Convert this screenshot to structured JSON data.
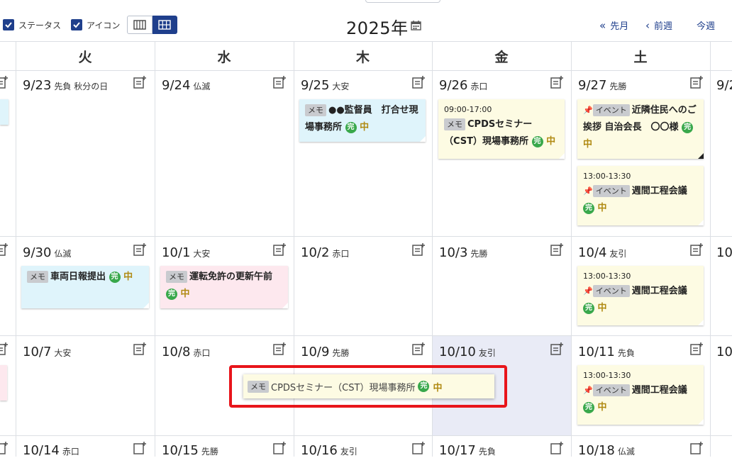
{
  "toolbar": {
    "status_label": "ステータス",
    "icon_label": "アイコン",
    "year": "2025年",
    "nav_prev_month": "先月",
    "nav_prev_week": "前週",
    "nav_this_week": "今週"
  },
  "weekdays": [
    "火",
    "水",
    "木",
    "金",
    "土"
  ],
  "cells": {
    "c_0923": {
      "date": "9/23",
      "rokuyo": "先負 秋分の日"
    },
    "c_0924": {
      "date": "9/24",
      "rokuyo": "仏滅"
    },
    "c_0925": {
      "date": "9/25",
      "rokuyo": "大安"
    },
    "c_0926": {
      "date": "9/26",
      "rokuyo": "赤口"
    },
    "c_0927": {
      "date": "9/27",
      "rokuyo": "先勝"
    },
    "c_0928": {
      "date": "9/2"
    },
    "c_0930": {
      "date": "9/30",
      "rokuyo": "仏滅"
    },
    "c_1001": {
      "date": "10/1",
      "rokuyo": "大安"
    },
    "c_1002": {
      "date": "10/2",
      "rokuyo": "赤口"
    },
    "c_1003": {
      "date": "10/3",
      "rokuyo": "先勝"
    },
    "c_1004": {
      "date": "10/4",
      "rokuyo": "友引"
    },
    "c_1005": {
      "date": "10"
    },
    "c_1007": {
      "date": "10/7",
      "rokuyo": "大安"
    },
    "c_1008": {
      "date": "10/8",
      "rokuyo": "赤口"
    },
    "c_1009": {
      "date": "10/9",
      "rokuyo": "先勝"
    },
    "c_1010": {
      "date": "10/10",
      "rokuyo": "友引"
    },
    "c_1011": {
      "date": "10/11",
      "rokuyo": "先負"
    },
    "c_1012": {
      "date": "10"
    },
    "c_1014": {
      "date": "10/14",
      "rokuyo": "赤口"
    },
    "c_1015": {
      "date": "10/15",
      "rokuyo": "先勝"
    },
    "c_1016": {
      "date": "10/16",
      "rokuyo": "友引"
    },
    "c_1017": {
      "date": "10/17",
      "rokuyo": "先負"
    },
    "c_1018": {
      "date": "10/18",
      "rokuyo": "仏滅"
    }
  },
  "events": {
    "e1": {
      "tag": "メモ",
      "title": "●●監督員　打合せ現場事務所",
      "done": "完",
      "priority": "中"
    },
    "e2": {
      "time": "09:00-17:00",
      "tag": "メモ",
      "title": "CPDSセミナー（CST）現場事務所",
      "done": "完",
      "priority": "中"
    },
    "e3": {
      "tag": "イベント",
      "title": "近隣住民へのご挨拶 自治会長　〇〇様",
      "done": "完",
      "priority": "中"
    },
    "e4": {
      "time": "13:00-13:30",
      "tag": "イベント",
      "title": "週間工程会議",
      "done": "完",
      "priority": "中"
    },
    "e5": {
      "tag": "メモ",
      "title": "車両日報提出",
      "done": "完",
      "priority": "中"
    },
    "e6": {
      "tag": "メモ",
      "title": "運転免許の更新午前",
      "done": "完",
      "priority": "中"
    },
    "e7": {
      "time": "13:00-13:30",
      "tag": "イベント",
      "title": "週間工程会議",
      "done": "完",
      "priority": "中"
    },
    "e8": {
      "time": "13:00-13:30",
      "tag": "イベント",
      "title": "週間工程会議",
      "done": "完",
      "priority": "中"
    }
  },
  "drag_event": {
    "tag": "メモ",
    "title": "CPDSセミナー（CST）現場事務所",
    "done": "完",
    "priority": "中"
  },
  "colors": {
    "accent": "#1f3f8c",
    "done_green": "#39a84b",
    "priority": "#b08a12",
    "highlight": "#e8151b",
    "today": "#e9ebf6"
  }
}
